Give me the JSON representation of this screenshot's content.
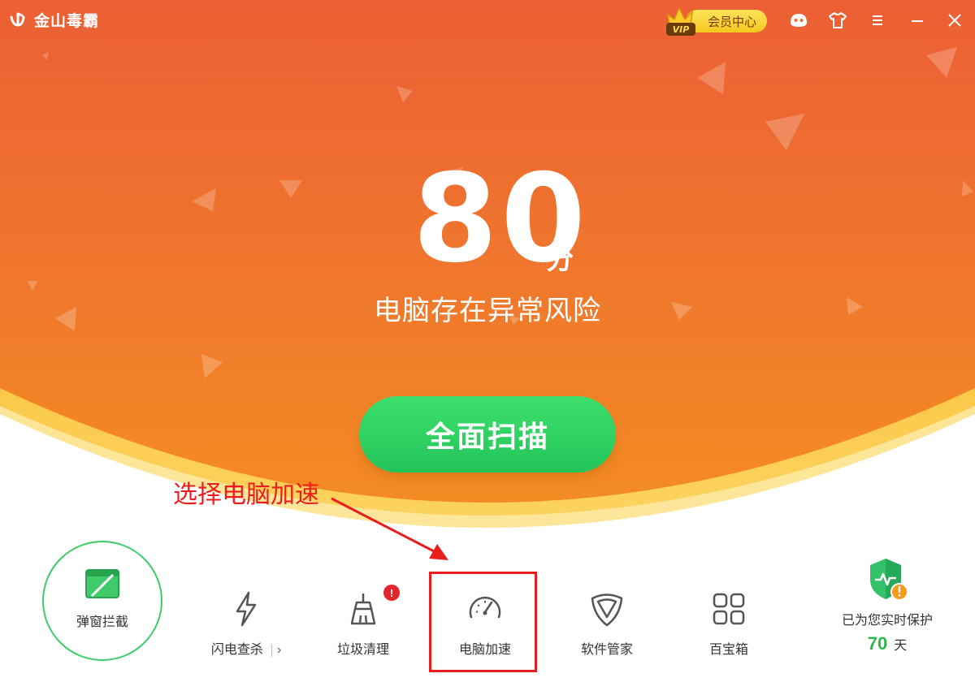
{
  "app": {
    "title": "金山毒霸"
  },
  "titlebar": {
    "vip_badge": "VIP",
    "vip_label": "会员中心",
    "icons": [
      "robot-icon",
      "tshirt-icon",
      "menu-icon",
      "minimize-icon",
      "close-icon"
    ]
  },
  "score": {
    "value": "80",
    "unit": "分",
    "status": "电脑存在异常风险"
  },
  "scan_button": {
    "label": "全面扫描"
  },
  "annotation": {
    "text": "选择电脑加速"
  },
  "tools": {
    "popup_block": "弹窗拦截",
    "flash_scan": "闪电查杀",
    "flash_scan_more": "›",
    "junk_clean": "垃圾清理",
    "junk_clean_badge": "!",
    "pc_speedup": "电脑加速",
    "software_manager": "软件管家",
    "toolbox": "百宝箱"
  },
  "protection": {
    "text": "已为您实时保护",
    "days": "70",
    "unit": "天"
  },
  "colors": {
    "accent_orange": "#ec5f35",
    "scan_green": "#2ecc63",
    "annotation_red": "#e81d1d",
    "vip_gold": "#f6c81f"
  }
}
